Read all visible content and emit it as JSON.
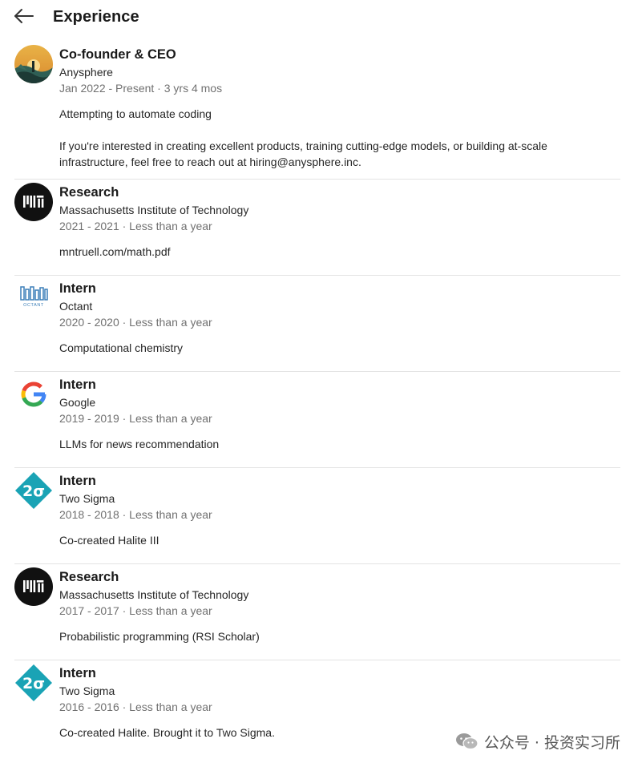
{
  "header": {
    "title": "Experience",
    "back_icon": "arrow-left-icon"
  },
  "entries": [
    {
      "logo": "anysphere-logo",
      "role": "Co-founder & CEO",
      "company": "Anysphere",
      "dates": "Jan 2022 - Present · 3 yrs 4 mos",
      "description": "Attempting to automate coding",
      "description2": "If you're interested in creating excellent products, training cutting-edge models, or building at-scale infrastructure, feel free to reach out at hiring@anysphere.inc."
    },
    {
      "logo": "mit-logo",
      "role": "Research",
      "company": "Massachusetts Institute of Technology",
      "dates": "2021 - 2021 · Less than a year",
      "description": "mntruell.com/math.pdf"
    },
    {
      "logo": "octant-logo",
      "role": "Intern",
      "company": "Octant",
      "dates": "2020 - 2020 · Less than a year",
      "description": "Computational chemistry"
    },
    {
      "logo": "google-logo",
      "role": "Intern",
      "company": "Google",
      "dates": "2019 - 2019 · Less than a year",
      "description": "LLMs for news recommendation"
    },
    {
      "logo": "two-sigma-logo",
      "role": "Intern",
      "company": "Two Sigma",
      "dates": "2018 - 2018 · Less than a year",
      "description": "Co-created Halite III"
    },
    {
      "logo": "mit-logo",
      "role": "Research",
      "company": "Massachusetts Institute of Technology",
      "dates": "2017 - 2017 · Less than a year",
      "description": "Probabilistic programming (RSI Scholar)"
    },
    {
      "logo": "two-sigma-logo",
      "role": "Intern",
      "company": "Two Sigma",
      "dates": "2016 - 2016 · Less than a year",
      "description": "Co-created Halite. Brought it to Two Sigma."
    }
  ],
  "watermark": {
    "text": "公众号 · 投资实习所",
    "icon": "wechat-icon"
  },
  "colors": {
    "divider": "#e3e3e3",
    "muted_text": "#707070",
    "two_sigma_teal": "#1aa3b5",
    "google_blue": "#4285F4",
    "google_red": "#EA4335",
    "google_yellow": "#FBBC05",
    "google_green": "#34A853"
  }
}
